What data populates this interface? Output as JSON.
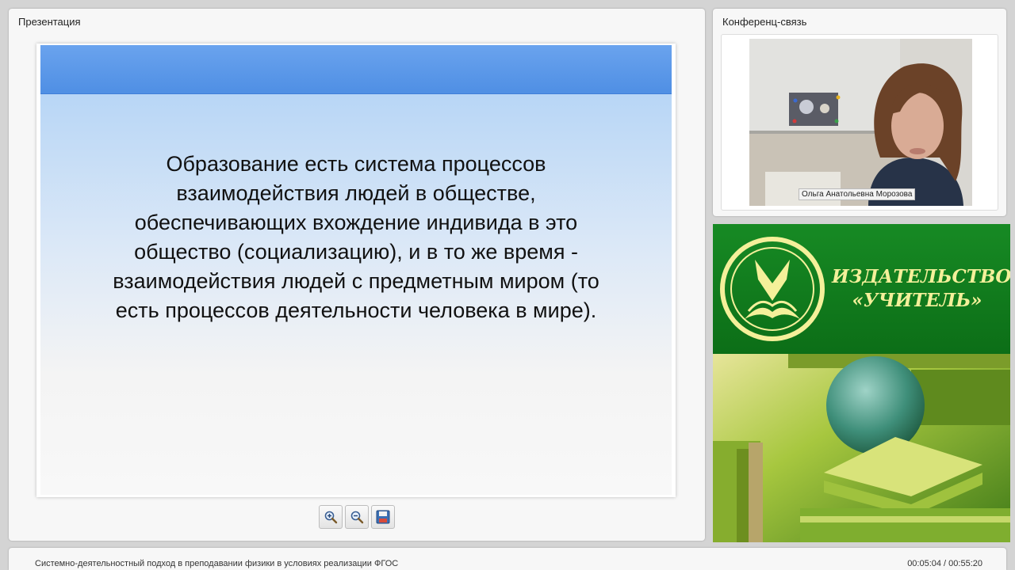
{
  "presentation": {
    "title": "Презентация",
    "slide_lines": [
      "Образование  есть система процессов",
      "взаимодействия людей в обществе,",
      "обеспечивающих вхождение индивида в это",
      "общество (социализацию), и в то же время -",
      "взаимодействия людей с предметным миром (то",
      "есть процессов деятельности человека в мире)."
    ],
    "toolbar": [
      "zoom-in-icon",
      "zoom-out-icon",
      "save-icon"
    ]
  },
  "conference": {
    "title": "Конференц-связь",
    "participant_name": "Ольга Анатольевна Морозова"
  },
  "banner": {
    "line1": "ИЗДАТЕЛЬСТВО",
    "line2": "«УЧИТЕЛЬ»"
  },
  "footer": {
    "title": "Системно-деятельностный подход в преподавании физики в условиях реализации ФГОС",
    "time": "00:05:04 / 00:55:20"
  },
  "colors": {
    "slide_header": "#4f8fe4",
    "banner_green": "#0c6e17",
    "banner_text": "#f4f09a"
  }
}
